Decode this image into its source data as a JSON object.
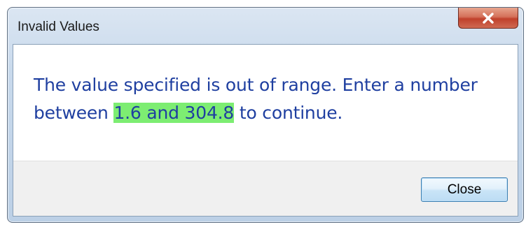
{
  "window": {
    "title": "Invalid Values"
  },
  "message": {
    "before": "The value specified is out of range. Enter a number between ",
    "range": "1.6 and 304.8",
    "after": " to continue."
  },
  "footer": {
    "close_label": "Close"
  },
  "icons": {
    "title_close": "close-icon"
  },
  "colors": {
    "message_text": "#1f3fa0",
    "highlight": "#7ded72",
    "close_button_red": "#c0412c"
  }
}
